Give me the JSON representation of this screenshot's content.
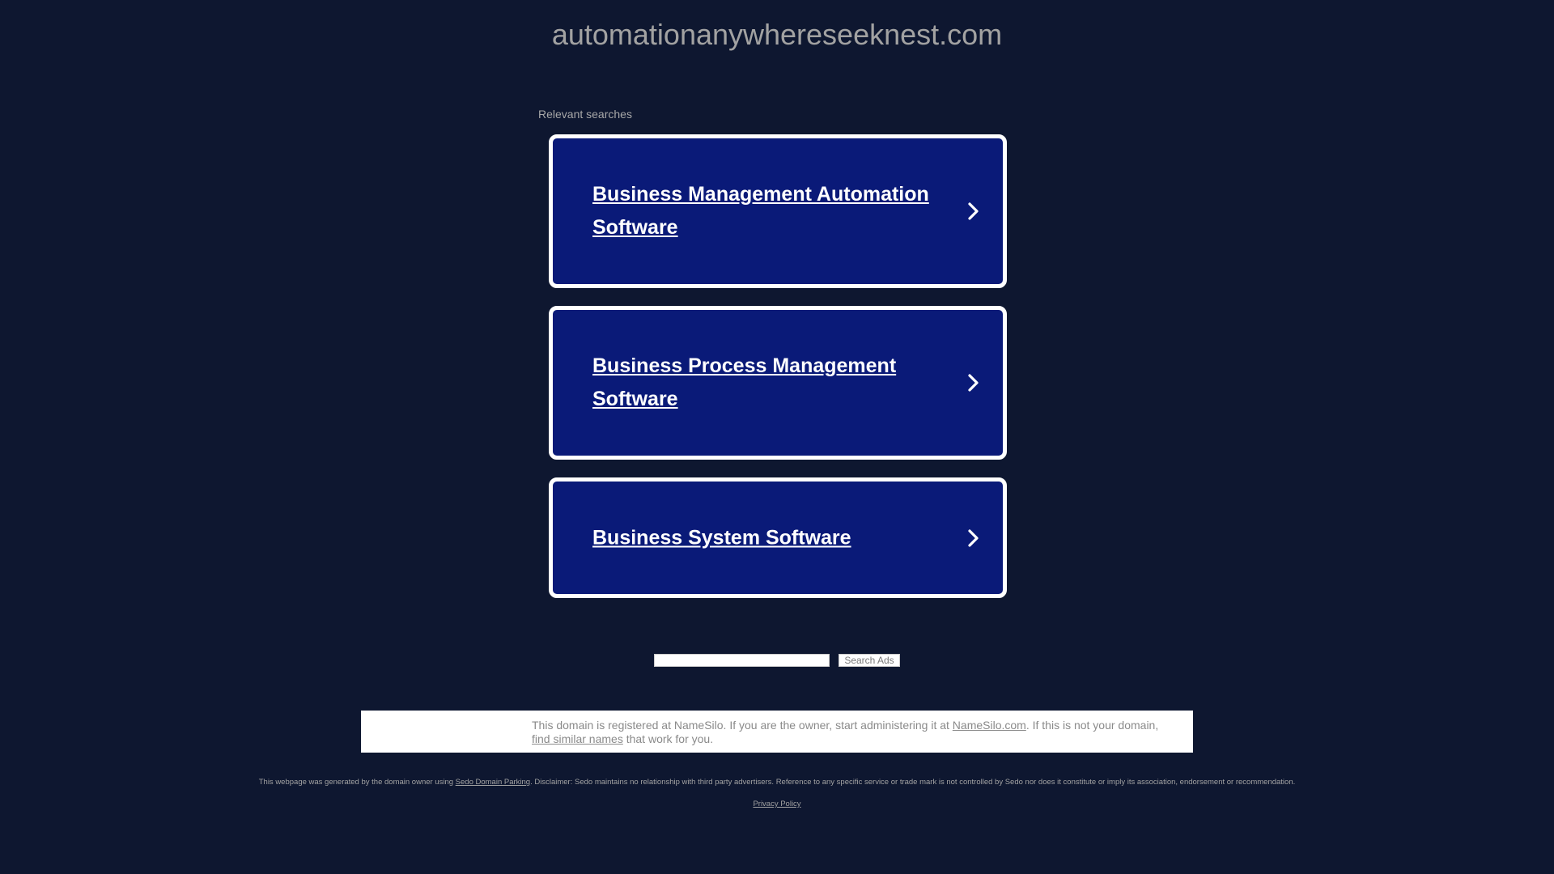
{
  "domain_title": "automationanywhereseeknest.com",
  "relevant_searches_label": "Relevant searches",
  "cards": [
    {
      "label": "Business Management Automation Software"
    },
    {
      "label": "Business Process Management Software"
    },
    {
      "label": "Business System Software"
    }
  ],
  "search": {
    "input_value": "",
    "button_label": "Search Ads"
  },
  "notice": {
    "text_1": "This domain is registered at NameSilo. If you are the owner, start administering it at ",
    "link_namesilo": "NameSilo.com",
    "text_2": ". If this is not your domain, ",
    "link_similar": "find similar names",
    "text_3": " that work for you."
  },
  "disclaimer": {
    "text_1": "This webpage was generated by the domain owner using ",
    "link_sedo": "Sedo Domain Parking",
    "text_2": ". Disclaimer: Sedo maintains no relationship with third party advertisers. Reference to any specific service or trade mark is not controlled by Sedo nor does it constitute or imply its association, endorsement or recommendation."
  },
  "privacy_policy": "Privacy Policy",
  "colors": {
    "background": "#0e1730",
    "card_background": "#0a1a78",
    "card_border": "#ffffff",
    "muted_text": "#a2a2a2"
  },
  "icons": {
    "card_chevron": "chevron-right-icon"
  }
}
